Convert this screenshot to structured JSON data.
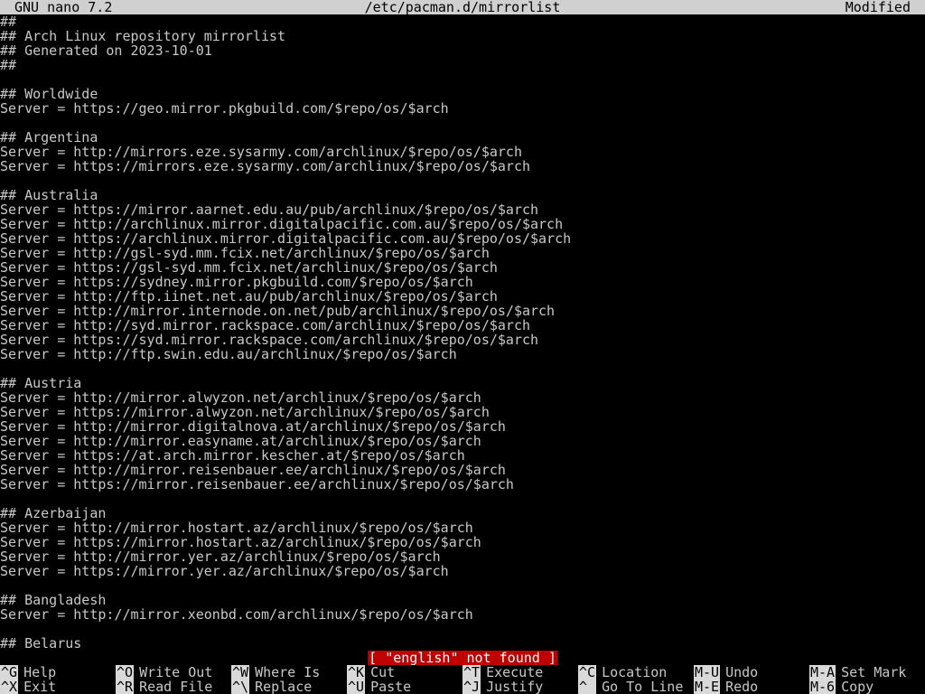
{
  "app": {
    "name": "GNU nano 7.2",
    "file_path": "/etc/pacman.d/mirrorlist",
    "state": "Modified"
  },
  "colors": {
    "background": "#000000",
    "text": "#c8c8c8",
    "title_bar": "#d0d0d0",
    "key_badge": "#d9d9d9",
    "status_badge": "#c00000"
  },
  "editor": {
    "lines": [
      "##",
      "## Arch Linux repository mirrorlist",
      "## Generated on 2023-10-01",
      "##",
      "",
      "## Worldwide",
      "Server = https://geo.mirror.pkgbuild.com/$repo/os/$arch",
      "",
      "## Argentina",
      "Server = http://mirrors.eze.sysarmy.com/archlinux/$repo/os/$arch",
      "Server = https://mirrors.eze.sysarmy.com/archlinux/$repo/os/$arch",
      "",
      "## Australia",
      "Server = https://mirror.aarnet.edu.au/pub/archlinux/$repo/os/$arch",
      "Server = http://archlinux.mirror.digitalpacific.com.au/$repo/os/$arch",
      "Server = https://archlinux.mirror.digitalpacific.com.au/$repo/os/$arch",
      "Server = http://gsl-syd.mm.fcix.net/archlinux/$repo/os/$arch",
      "Server = https://gsl-syd.mm.fcix.net/archlinux/$repo/os/$arch",
      "Server = https://sydney.mirror.pkgbuild.com/$repo/os/$arch",
      "Server = http://ftp.iinet.net.au/pub/archlinux/$repo/os/$arch",
      "Server = http://mirror.internode.on.net/pub/archlinux/$repo/os/$arch",
      "Server = http://syd.mirror.rackspace.com/archlinux/$repo/os/$arch",
      "Server = https://syd.mirror.rackspace.com/archlinux/$repo/os/$arch",
      "Server = http://ftp.swin.edu.au/archlinux/$repo/os/$arch",
      "",
      "## Austria",
      "Server = http://mirror.alwyzon.net/archlinux/$repo/os/$arch",
      "Server = https://mirror.alwyzon.net/archlinux/$repo/os/$arch",
      "Server = http://mirror.digitalnova.at/archlinux/$repo/os/$arch",
      "Server = http://mirror.easyname.at/archlinux/$repo/os/$arch",
      "Server = https://at.arch.mirror.kescher.at/$repo/os/$arch",
      "Server = http://mirror.reisenbauer.ee/archlinux/$repo/os/$arch",
      "Server = https://mirror.reisenbauer.ee/archlinux/$repo/os/$arch",
      "",
      "## Azerbaijan",
      "Server = http://mirror.hostart.az/archlinux/$repo/os/$arch",
      "Server = https://mirror.hostart.az/archlinux/$repo/os/$arch",
      "Server = http://mirror.yer.az/archlinux/$repo/os/$arch",
      "Server = https://mirror.yer.az/archlinux/$repo/os/$arch",
      "",
      "## Bangladesh",
      "Server = http://mirror.xeonbd.com/archlinux/$repo/os/$arch",
      "",
      "## Belarus"
    ]
  },
  "status": {
    "message": "[ \"english\" not found ]"
  },
  "shortcuts": {
    "row1": [
      {
        "key": "^G",
        "label": "Help"
      },
      {
        "key": "^O",
        "label": "Write Out"
      },
      {
        "key": "^W",
        "label": "Where Is"
      },
      {
        "key": "^K",
        "label": "Cut"
      },
      {
        "key": "^T",
        "label": "Execute"
      },
      {
        "key": "^C",
        "label": "Location"
      },
      {
        "key": "M-U",
        "label": "Undo"
      },
      {
        "key": "M-A",
        "label": "Set Mark"
      }
    ],
    "row2": [
      {
        "key": "^X",
        "label": "Exit"
      },
      {
        "key": "^R",
        "label": "Read File"
      },
      {
        "key": "^\\",
        "label": "Replace"
      },
      {
        "key": "^U",
        "label": "Paste"
      },
      {
        "key": "^J",
        "label": "Justify"
      },
      {
        "key": "^_",
        "label": "Go To Line"
      },
      {
        "key": "M-E",
        "label": "Redo"
      },
      {
        "key": "M-6",
        "label": "Copy"
      }
    ]
  }
}
